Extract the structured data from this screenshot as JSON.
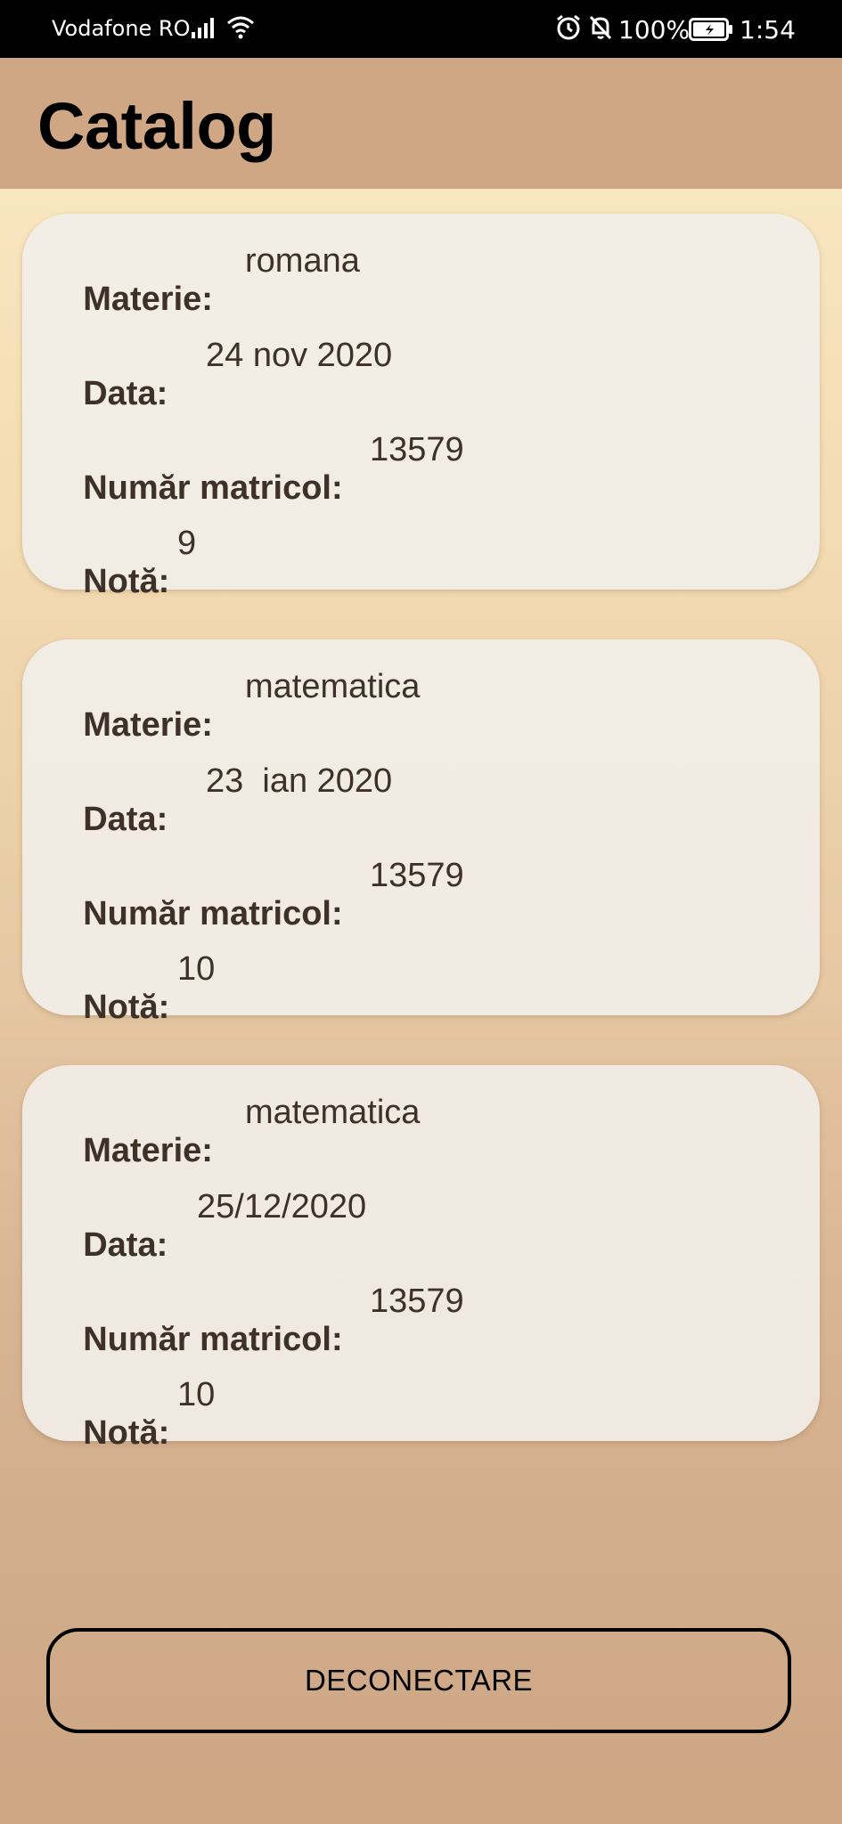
{
  "status_bar": {
    "carrier": "Vodafone RO",
    "battery": "100%",
    "time": "1:54",
    "icons": [
      "signal-icon",
      "wifi-icon",
      "alarm-icon",
      "notifications-off-icon",
      "battery-charging-icon"
    ]
  },
  "app_bar": {
    "title": "Catalog"
  },
  "labels": {
    "subject": "Materie:",
    "date": "Data:",
    "student_id": "Număr matricol:",
    "grade": "Notă:"
  },
  "grades": [
    {
      "subject": "romana",
      "date": "24 nov 2020",
      "student_id": "13579",
      "grade": "9"
    },
    {
      "subject": "matematica",
      "date": "23  ian 2020",
      "student_id": "13579",
      "grade": "10"
    },
    {
      "subject": "matematica",
      "date": "25/12/2020",
      "student_id": "13579",
      "grade": "10"
    }
  ],
  "logout_button": "DECONECTARE",
  "colors": {
    "app_bar": "#cfa784",
    "card": "#f1eee8",
    "text": "#3d3128"
  }
}
